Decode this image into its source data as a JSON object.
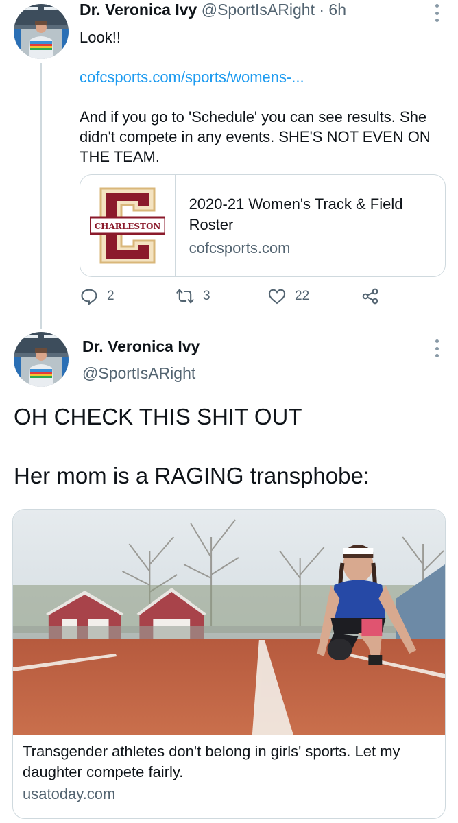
{
  "tweet1": {
    "author_name": "Dr. Veronica Ivy",
    "handle": "@SportIsARight",
    "separator": "·",
    "time": "6h",
    "line_look": "Look!!",
    "link_text": "cofcsports.com/sports/womens-...",
    "paragraph": "And if you go to 'Schedule' you can see results. She didn't compete in any events. SHE'S NOT EVEN ON THE TEAM.",
    "card": {
      "logo_text": "CHARLESTON",
      "title": "2020-21 Women's Track & Field Roster",
      "domain": "cofcsports.com"
    },
    "actions": {
      "reply_count": "2",
      "retweet_count": "3",
      "like_count": "22"
    }
  },
  "tweet2": {
    "author_name": "Dr. Veronica Ivy",
    "handle": "@SportIsARight",
    "text_line1": "OH CHECK THIS SHIT OUT",
    "text_line2": "Her mom is a RAGING transphobe:",
    "card": {
      "title": "Transgender athletes don't belong in girls' sports. Let my daughter compete fairly.",
      "domain": "usatoday.com"
    }
  },
  "icons": [
    "more-options-icon",
    "reply-icon",
    "retweet-icon",
    "like-icon",
    "share-icon"
  ],
  "colors": {
    "link": "#1d9bf0",
    "secondary_text": "#536471",
    "border": "#cfd9de",
    "charleston_maroon": "#8b1a2b",
    "charleston_gold": "#d9b77a"
  }
}
